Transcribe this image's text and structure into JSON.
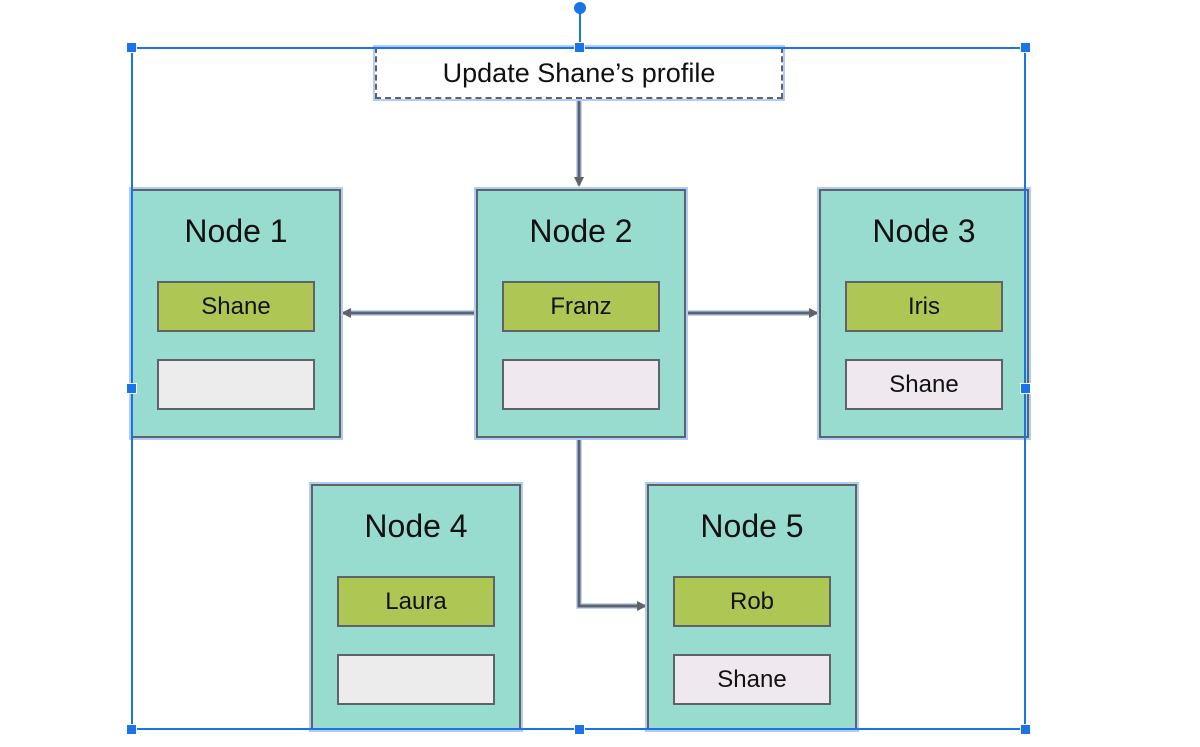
{
  "diagram": {
    "title": "Update Shane’s profile",
    "nodes": [
      {
        "id": "node-1",
        "title": "Node 1",
        "primary": "Shane",
        "replica": ""
      },
      {
        "id": "node-2",
        "title": "Node 2",
        "primary": "Franz",
        "replica": ""
      },
      {
        "id": "node-3",
        "title": "Node 3",
        "primary": "Iris",
        "replica": "Shane"
      },
      {
        "id": "node-4",
        "title": "Node 4",
        "primary": "Laura",
        "replica": ""
      },
      {
        "id": "node-5",
        "title": "Node 5",
        "primary": "Rob",
        "replica": "Shane"
      }
    ],
    "edges": [
      {
        "from": "title",
        "to": "Node 2"
      },
      {
        "from": "Node 2",
        "to": "Node 1"
      },
      {
        "from": "Node 2",
        "to": "Node 3"
      },
      {
        "from": "Node 2",
        "to": "Node 5"
      }
    ],
    "colors": {
      "node_fill": "#98dccf",
      "primary_fill": "#aec654",
      "replica_fill": "#efe9ef",
      "empty_fill": "#ececec",
      "edge": "#5f6368",
      "selection": "#1a73e8"
    }
  }
}
